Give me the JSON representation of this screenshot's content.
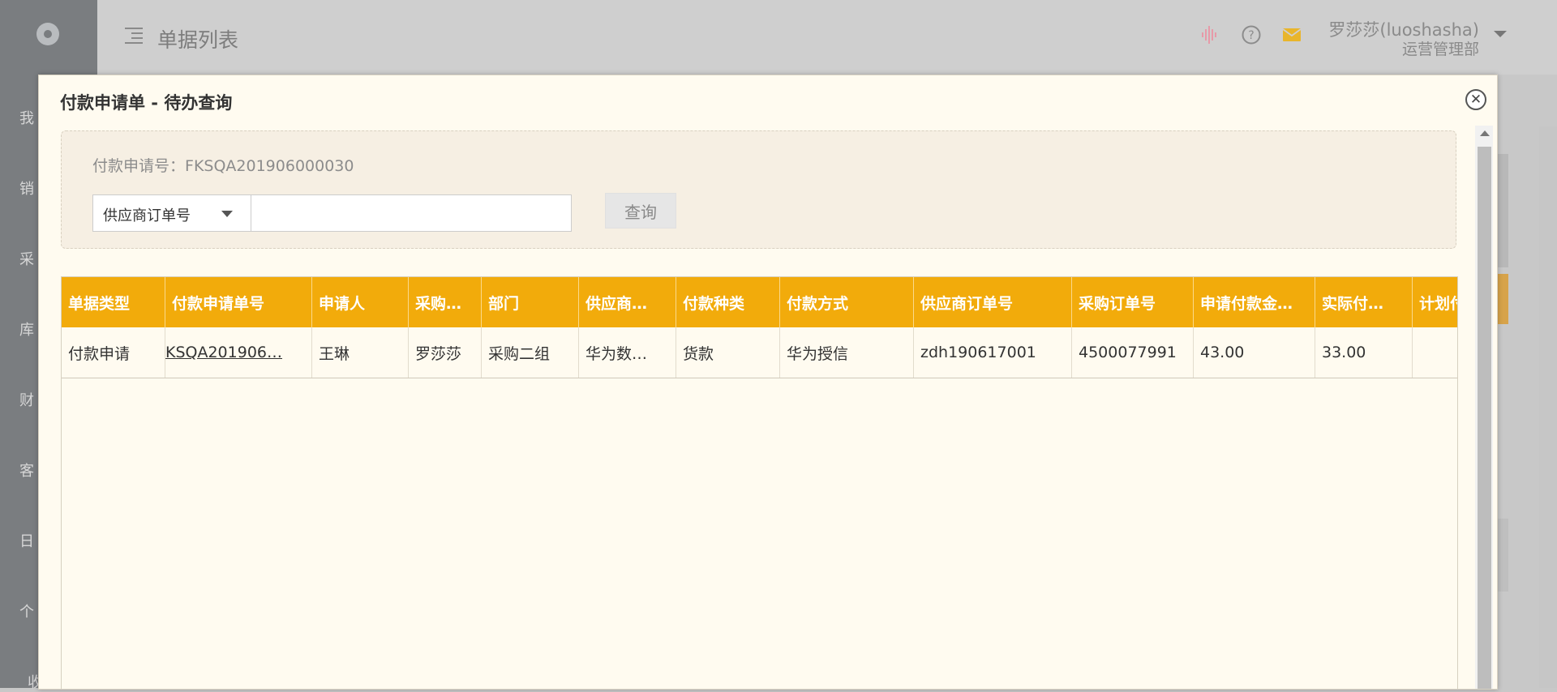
{
  "app": {
    "page_title": "单据列表",
    "user": {
      "name": "罗莎莎(luoshasha)",
      "dept": "运营管理部"
    },
    "nav_items": [
      "我",
      "销",
      "采",
      "库",
      "财",
      "客",
      "日",
      "个",
      "收"
    ],
    "accent_colors": {
      "header_orange": "#f2ab0b",
      "mail_icon": "#e9b52b",
      "audio_icon": "#e79aa8"
    }
  },
  "modal": {
    "title": "付款申请单 - 待办查询",
    "close_icon": "close-icon",
    "search": {
      "info_label": "付款申请号：",
      "info_value": "FKSQA201906000030",
      "field_select": "供应商订单号",
      "input_value": "",
      "query_button": "查询"
    },
    "table": {
      "columns": [
        "单据类型",
        "付款申请单号",
        "申请人",
        "采购…",
        "部门",
        "供应商…",
        "付款种类",
        "付款方式",
        "供应商订单号",
        "采购订单号",
        "申请付款金…",
        "实际付…",
        "计划付"
      ],
      "rows": [
        [
          "付款申请",
          "KSQA201906…",
          "王琳",
          "罗莎莎",
          "采购二组",
          "华为数…",
          "货款",
          "华为授信",
          "zdh190617001",
          "4500077991",
          "43.00",
          "33.00",
          ""
        ]
      ]
    }
  }
}
